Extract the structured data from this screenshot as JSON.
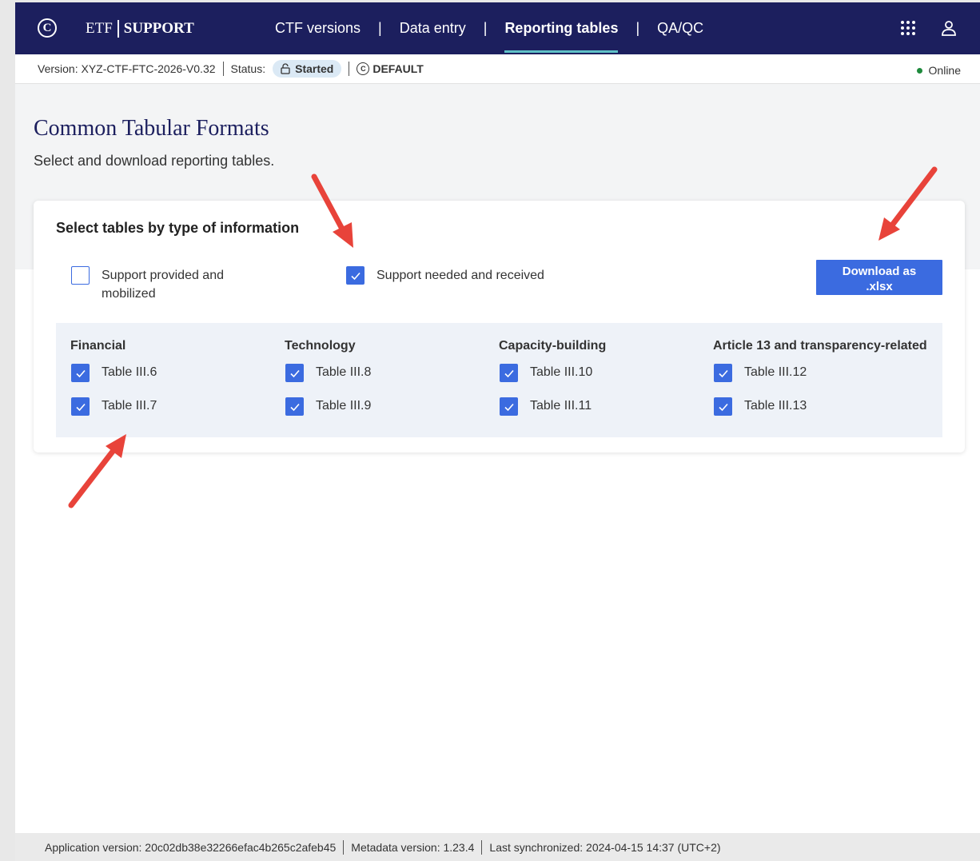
{
  "brand": {
    "part1": "ETF",
    "part2": "SUPPORT"
  },
  "nav": {
    "items": [
      {
        "label": "CTF versions"
      },
      {
        "label": "Data entry"
      },
      {
        "label": "Reporting tables"
      },
      {
        "label": "QA/QC"
      }
    ],
    "separator": "|"
  },
  "status_bar": {
    "version": "Version: XYZ-CTF-FTC-2026-V0.32",
    "status_label": "Status:",
    "status_value": "Started",
    "profile": "DEFAULT",
    "online": "Online"
  },
  "page": {
    "title": "Common Tabular Formats",
    "subtitle": "Select and download reporting tables."
  },
  "card": {
    "title": "Select tables by type of information",
    "types": [
      {
        "label": "Support provided and mobilized",
        "checked": false
      },
      {
        "label": "Support needed and received",
        "checked": true
      }
    ],
    "download_button": {
      "line1": "Download as",
      "line2": ".xlsx"
    },
    "groups": [
      {
        "title": "Financial",
        "items": [
          {
            "label": "Table III.6",
            "checked": true
          },
          {
            "label": "Table III.7",
            "checked": true
          }
        ]
      },
      {
        "title": "Technology",
        "items": [
          {
            "label": "Table III.8",
            "checked": true
          },
          {
            "label": "Table III.9",
            "checked": true
          }
        ]
      },
      {
        "title": "Capacity-building",
        "items": [
          {
            "label": "Table III.10",
            "checked": true
          },
          {
            "label": "Table III.11",
            "checked": true
          }
        ]
      },
      {
        "title": "Article 13 and transparency-related",
        "items": [
          {
            "label": "Table III.12",
            "checked": true
          },
          {
            "label": "Table III.13",
            "checked": true
          }
        ]
      }
    ]
  },
  "footer": {
    "app_version": "Application version: 20c02db38e32266efac4b265c2afeb45",
    "metadata_version": "Metadata version: 1.23.4",
    "last_sync": "Last synchronized: 2024-04-15 14:37 (UTC+2)"
  },
  "colors": {
    "nav_bg": "#1c1f5e",
    "accent": "#3b6be0",
    "active_underline": "#5fc1c7",
    "online": "#1e8a3c",
    "arrow": "#e8433a"
  },
  "icons": [
    "unfccc-logo-icon",
    "apps-grid-icon",
    "user-icon",
    "lock-open-icon",
    "copyright-circle-icon",
    "check-icon"
  ]
}
